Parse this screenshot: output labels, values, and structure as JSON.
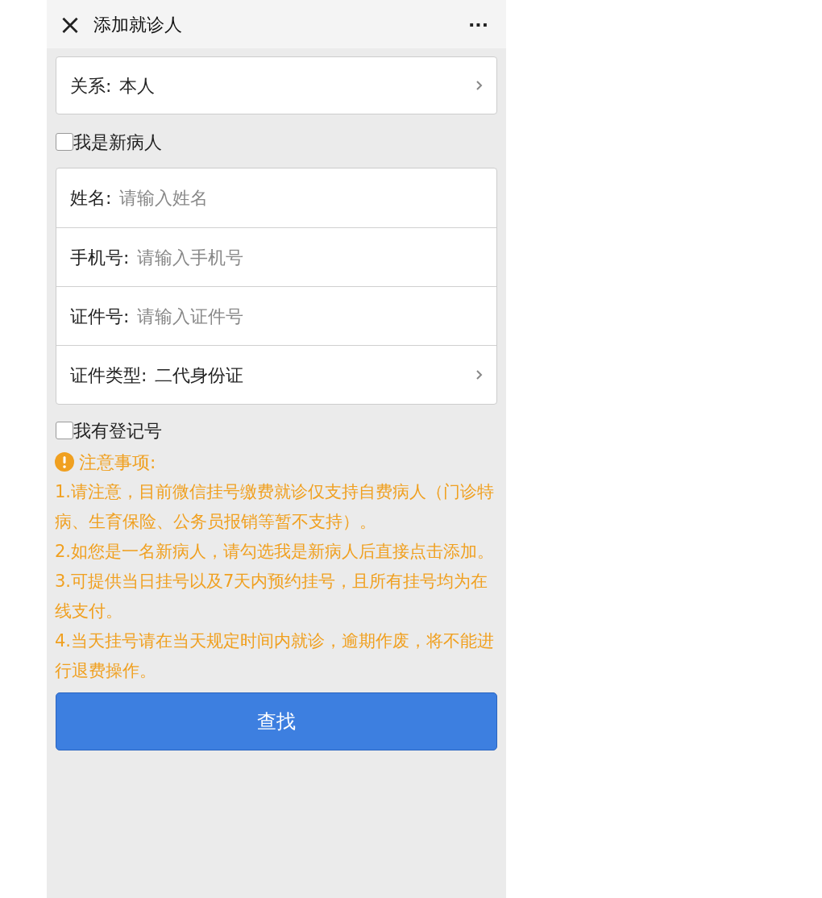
{
  "header": {
    "close": "×",
    "title": "添加就诊人",
    "more": "···"
  },
  "relation": {
    "label": "关系:",
    "value": "本人"
  },
  "new_patient": {
    "label": "我是新病人",
    "checked": false
  },
  "fields": [
    {
      "kind": "input",
      "label": "姓名:",
      "placeholder": "请输入姓名"
    },
    {
      "kind": "input",
      "label": "手机号:",
      "placeholder": "请输入手机号"
    },
    {
      "kind": "input",
      "label": "证件号:",
      "placeholder": "请输入证件号"
    },
    {
      "kind": "select",
      "label": "证件类型:",
      "value": "二代身份证"
    }
  ],
  "has_register_no": {
    "label": "我有登记号",
    "checked": false
  },
  "notice": {
    "title": "注意事项:",
    "items": [
      "1.请注意，目前微信挂号缴费就诊仅支持自费病人（门诊特病、生育保险、公务员报销等暂不支持）。",
      "2.如您是一名新病人，请勾选我是新病人后直接点击添加。",
      "3.可提供当日挂号以及7天内预约挂号，且所有挂号均为在线支付。",
      "4.当天挂号请在当天规定时间内就诊，逾期作废，将不能进行退费操作。"
    ]
  },
  "button": "查找"
}
